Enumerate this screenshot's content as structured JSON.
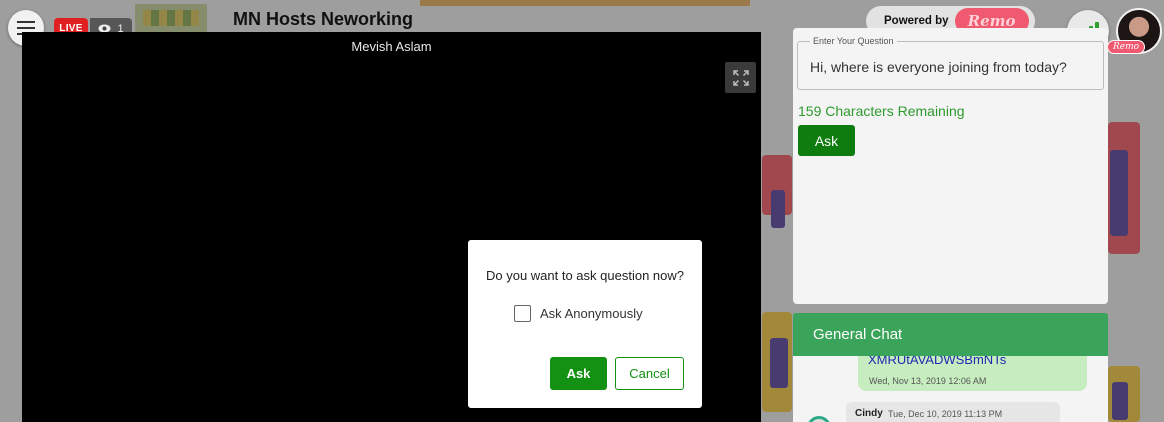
{
  "header": {
    "live_label": "LIVE",
    "viewer_count": "1",
    "event_title": "MN Hosts Neworking",
    "powered_by": "Powered by",
    "brand": "Remo",
    "avatar_tag": "Remo"
  },
  "video": {
    "speaker_name": "Mevish Aslam",
    "fullscreen_icon": "expand-icon"
  },
  "question_panel": {
    "field_label": "Enter Your Question",
    "field_value": "Hi, where is everyone joining from today?",
    "chars_remaining": "159 Characters Remaining",
    "ask_label": "Ask"
  },
  "chat": {
    "title": "General Chat",
    "messages": [
      {
        "text": "XMRUtAVADWSBmNTs",
        "time": "Wed, Nov 13, 2019 12:06 AM"
      },
      {
        "author": "Cindy",
        "time": "Tue, Dec 10, 2019 11:13 PM"
      }
    ]
  },
  "modal": {
    "question": "Do you want to ask question now?",
    "anonymous_label": "Ask Anonymously",
    "anonymous_checked": false,
    "ask_label": "Ask",
    "cancel_label": "Cancel"
  },
  "colors": {
    "accent_green": "#129112",
    "live_red": "#e02020",
    "brand_pink": "#f05a70",
    "chat_header": "#3aa45a"
  }
}
